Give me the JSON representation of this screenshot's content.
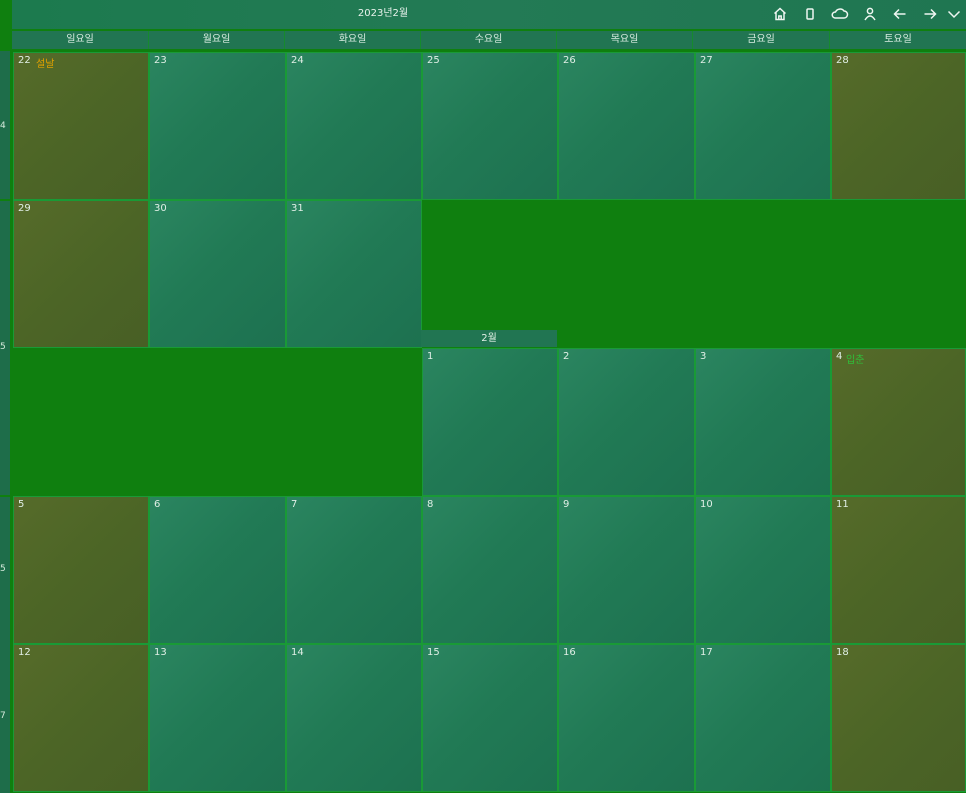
{
  "header": {
    "title": "2023년2월",
    "icons": [
      "home-icon",
      "tablet-icon",
      "cloud-icon",
      "user-icon",
      "arrow-left-icon",
      "arrow-right-icon",
      "chevron-down-icon"
    ]
  },
  "weekdays": [
    "일요일",
    "월요일",
    "화요일",
    "수요일",
    "목요일",
    "금요일",
    "토요일"
  ],
  "weeks": [
    "4",
    "5",
    "5",
    "7"
  ],
  "month_label": "2월",
  "days": {
    "r0": [
      "22",
      "23",
      "24",
      "25",
      "26",
      "27",
      "28"
    ],
    "r1": [
      "29",
      "30",
      "31"
    ],
    "r2": [
      "1",
      "2",
      "3",
      "4"
    ],
    "r3": [
      "5",
      "6",
      "7",
      "8",
      "9",
      "10",
      "11"
    ],
    "r4": [
      "12",
      "13",
      "14",
      "15",
      "16",
      "17",
      "18"
    ]
  },
  "holidays": {
    "seollal": "설날",
    "ipchun": "입춘"
  },
  "colors": {
    "background": "#0f7f0f",
    "weekday_cell": "#217a55",
    "weekend_cell": "#4c6526",
    "holiday_orange": "#e0a000",
    "holiday_green": "#2fbf3a"
  }
}
